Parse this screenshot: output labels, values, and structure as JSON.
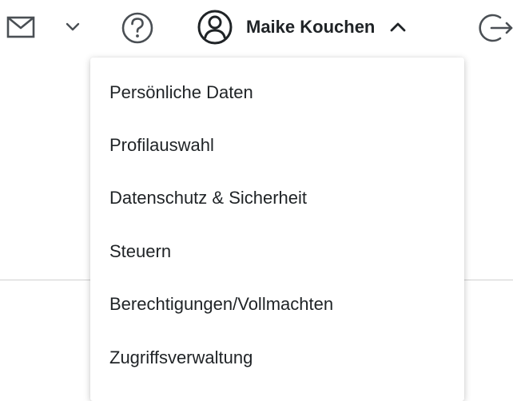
{
  "header": {
    "mail_icon": "envelope-icon",
    "mail_dropdown_icon": "chevron-down-icon",
    "help_icon": "question-circle-icon",
    "user_icon": "user-circle-icon",
    "user_name": "Maike Kouchen",
    "user_menu_icon": "chevron-up-icon",
    "logout_icon": "logout-icon"
  },
  "user_dropdown": {
    "items": [
      {
        "label": "Persönliche Daten"
      },
      {
        "label": "Profilauswahl"
      },
      {
        "label": "Datenschutz & Sicherheit"
      },
      {
        "label": "Steuern"
      },
      {
        "label": "Berechtigungen/Vollmachten"
      },
      {
        "label": "Zugriffsverwaltung"
      }
    ]
  },
  "colors": {
    "text": "#1f2326",
    "icon": "#4a4f54",
    "divider": "#cfcfcf",
    "background": "#ffffff"
  }
}
